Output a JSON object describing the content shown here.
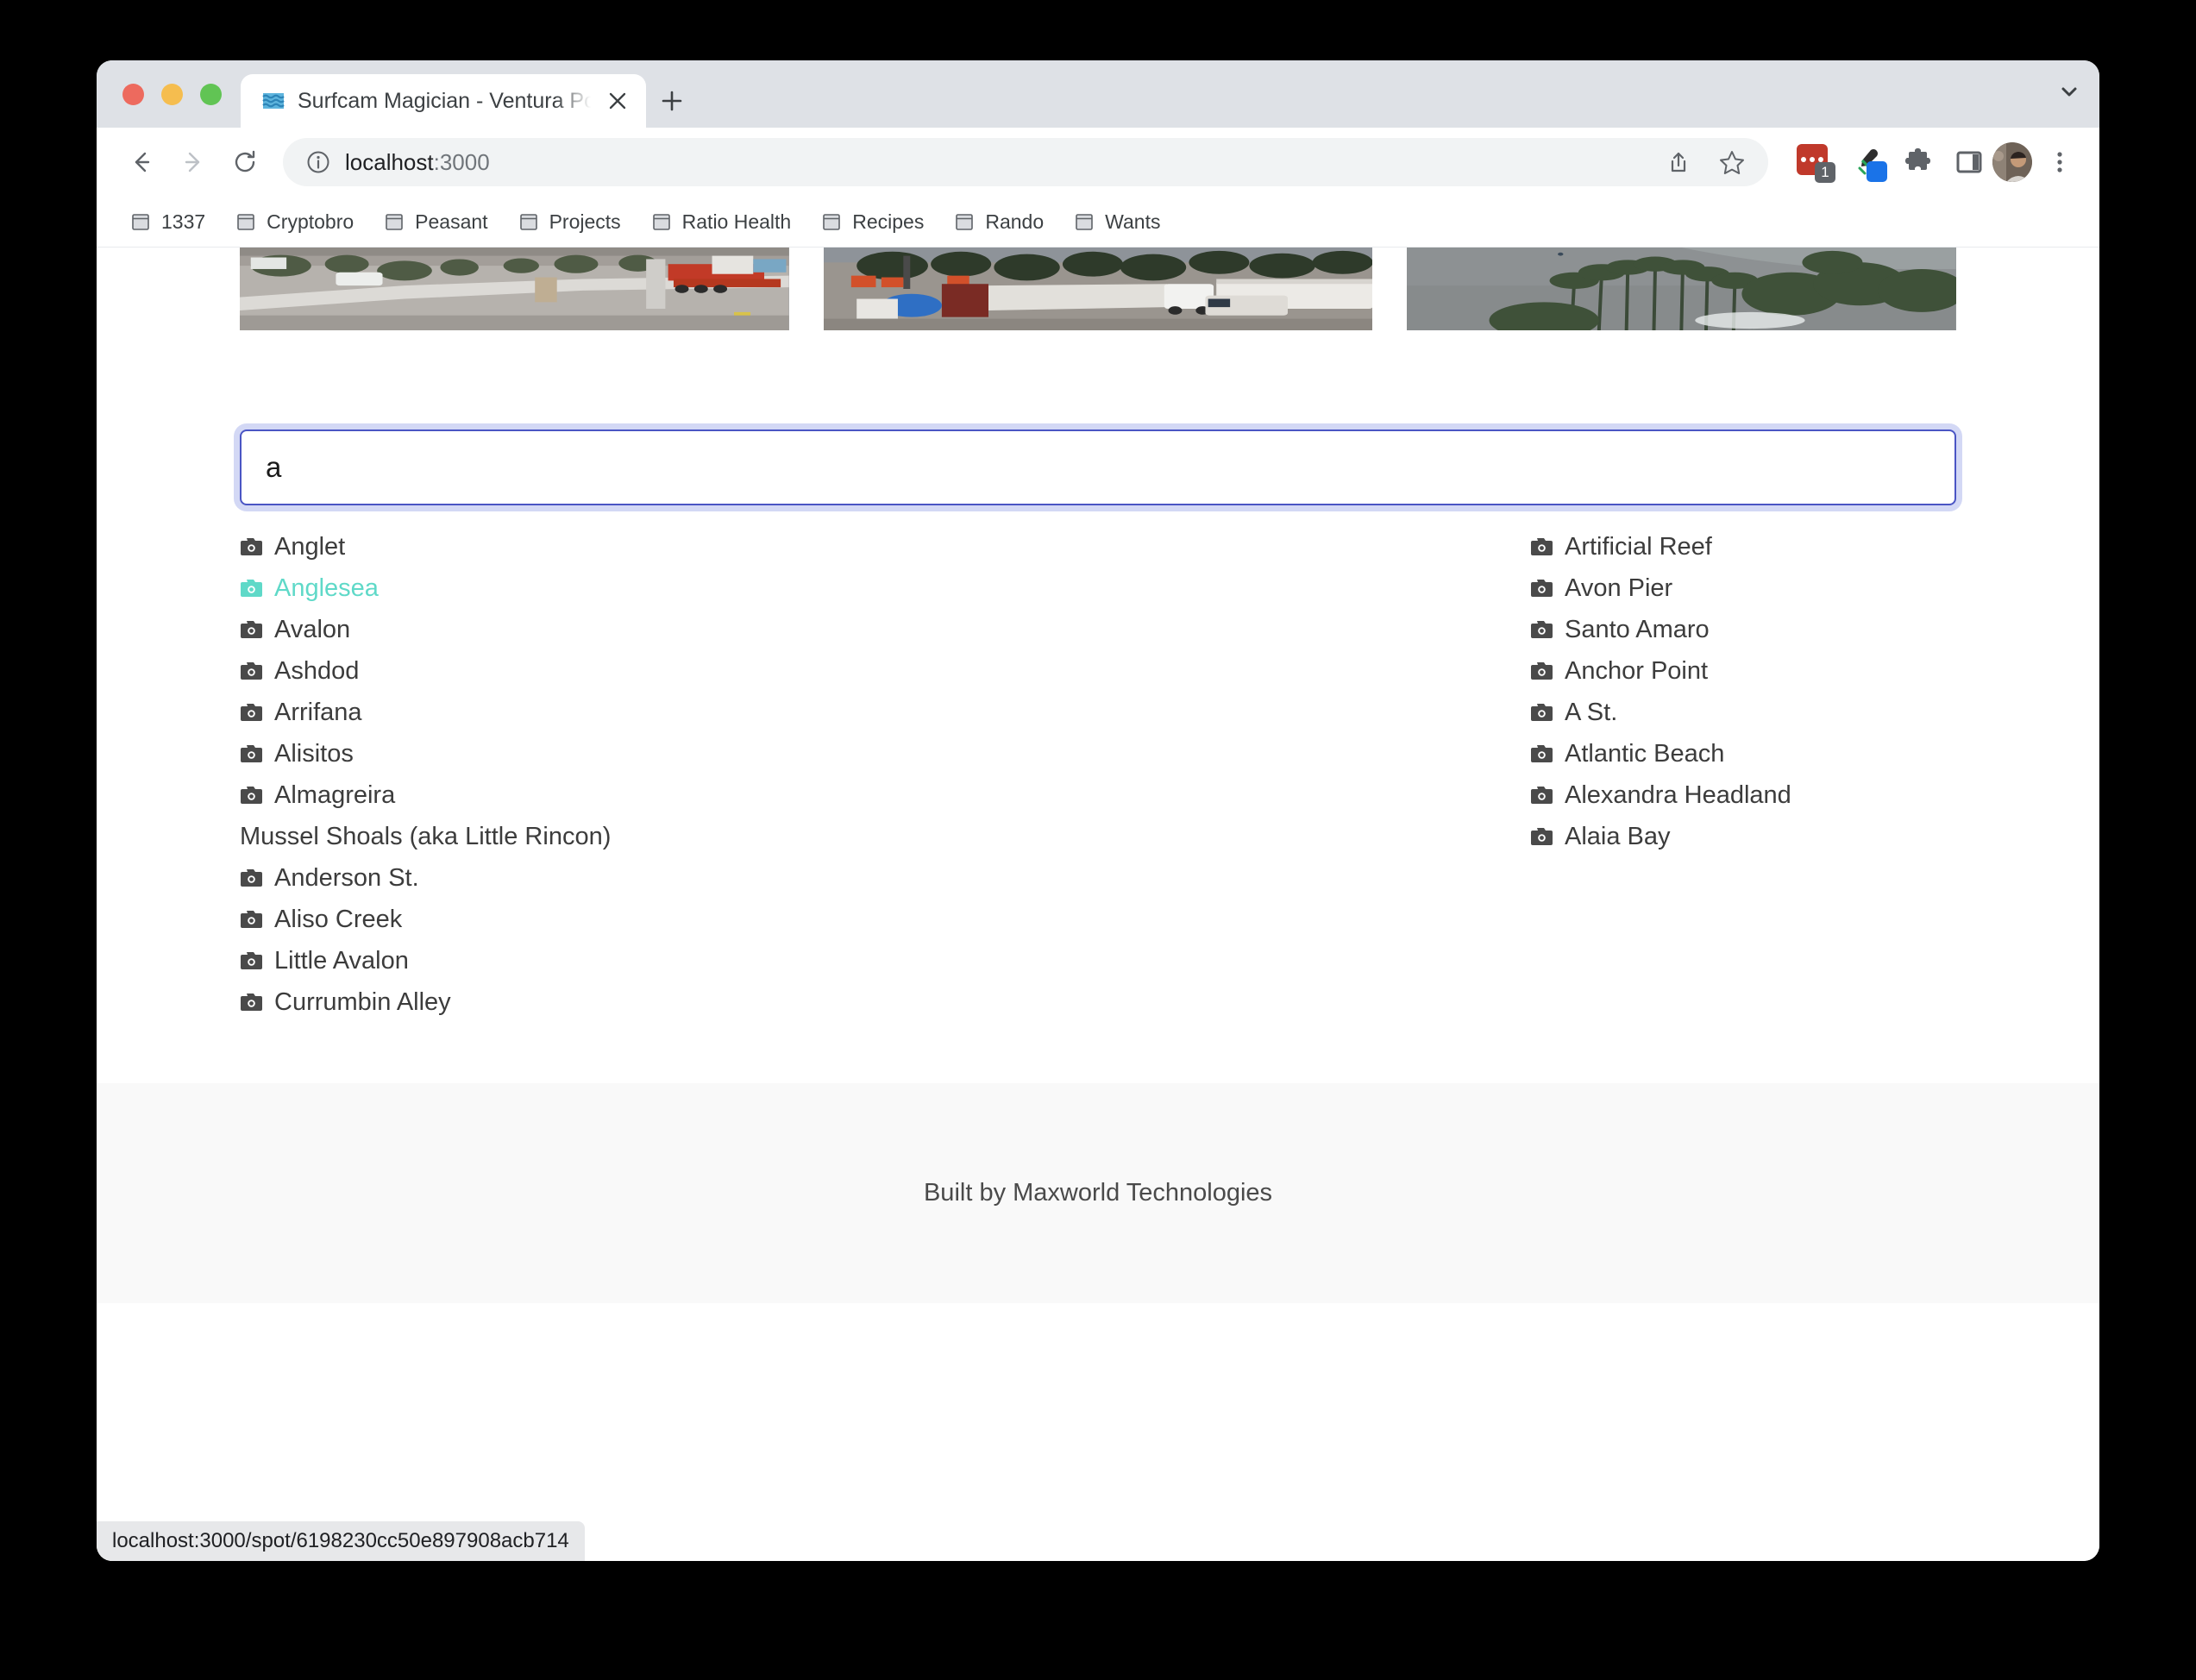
{
  "browser": {
    "tab": {
      "title": "Surfcam Magician - Ventura Po",
      "favicon_icon": "wave-favicon",
      "close_icon": "close-icon"
    },
    "new_tab_icon": "plus-icon",
    "tab_list_icon": "chevron-down-icon",
    "toolbar": {
      "back_icon": "back-arrow-icon",
      "forward_icon": "forward-arrow-icon",
      "reload_icon": "reload-icon",
      "info_icon": "info-circle-icon",
      "url_main": "localhost",
      "url_port": ":3000",
      "share_icon": "share-icon",
      "bookmark_icon": "star-icon",
      "extensions": [
        {
          "name": "ublock-origin-extension-icon",
          "badge": "1"
        },
        {
          "name": "eyedropper-extension-icon",
          "badge": ""
        },
        {
          "name": "puzzle-extensions-icon",
          "badge": ""
        },
        {
          "name": "side-panel-icon",
          "badge": ""
        }
      ],
      "avatar_icon": "profile-avatar",
      "menu_icon": "three-dot-menu-icon"
    },
    "bookmarks": [
      {
        "label": "1337",
        "icon": "folder-icon"
      },
      {
        "label": "Cryptobro",
        "icon": "folder-icon"
      },
      {
        "label": "Peasant",
        "icon": "folder-icon"
      },
      {
        "label": "Projects",
        "icon": "folder-icon"
      },
      {
        "label": "Ratio Health",
        "icon": "folder-icon"
      },
      {
        "label": "Recipes",
        "icon": "folder-icon"
      },
      {
        "label": "Rando",
        "icon": "folder-icon"
      },
      {
        "label": "Wants",
        "icon": "folder-icon"
      }
    ],
    "status_bubble": "localhost:3000/spot/6198230cc50e897908acb714"
  },
  "page": {
    "webcams": [
      {
        "name": "webcam-thumbnail-1",
        "alt": "Construction site with white tarp fence, parked cars and red flatbed truck"
      },
      {
        "name": "webcam-thumbnail-2",
        "alt": "RV park with trailers, trees and ocean in background"
      },
      {
        "name": "webcam-thumbnail-3",
        "alt": "Ocean point break with palm trees"
      }
    ],
    "search": {
      "value": "a",
      "placeholder": ""
    },
    "results": {
      "left_column": [
        {
          "label": "Anglet",
          "has_camera": true,
          "hover": false
        },
        {
          "label": "Anglesea",
          "has_camera": true,
          "hover": true
        },
        {
          "label": "Avalon",
          "has_camera": true,
          "hover": false
        },
        {
          "label": "Ashdod",
          "has_camera": true,
          "hover": false
        },
        {
          "label": "Arrifana",
          "has_camera": true,
          "hover": false
        },
        {
          "label": "Alisitos",
          "has_camera": true,
          "hover": false
        },
        {
          "label": "Almagreira",
          "has_camera": true,
          "hover": false
        },
        {
          "label": "Mussel Shoals (aka Little Rincon)",
          "has_camera": false,
          "hover": false
        },
        {
          "label": "Anderson St.",
          "has_camera": true,
          "hover": false
        },
        {
          "label": "Aliso Creek",
          "has_camera": true,
          "hover": false
        },
        {
          "label": "Little Avalon",
          "has_camera": true,
          "hover": false
        },
        {
          "label": "Currumbin Alley",
          "has_camera": true,
          "hover": false
        }
      ],
      "right_column": [
        {
          "label": "Artificial Reef",
          "has_camera": true,
          "hover": false
        },
        {
          "label": "Avon Pier",
          "has_camera": true,
          "hover": false
        },
        {
          "label": "Santo Amaro",
          "has_camera": true,
          "hover": false
        },
        {
          "label": "Anchor Point",
          "has_camera": true,
          "hover": false
        },
        {
          "label": "A St.",
          "has_camera": true,
          "hover": false
        },
        {
          "label": "Atlantic Beach",
          "has_camera": true,
          "hover": false
        },
        {
          "label": "Alexandra Headland",
          "has_camera": true,
          "hover": false
        },
        {
          "label": "Alaia Bay",
          "has_camera": true,
          "hover": false
        }
      ]
    },
    "footer": {
      "text": "Built by Maxworld Technologies"
    }
  },
  "colors": {
    "hover_accent": "#5fd9c8",
    "input_border": "#4a55c4",
    "input_focus_ring": "#d3d8f5",
    "text": "#3c3c3c",
    "footer_bg": "#f9f9f9"
  }
}
